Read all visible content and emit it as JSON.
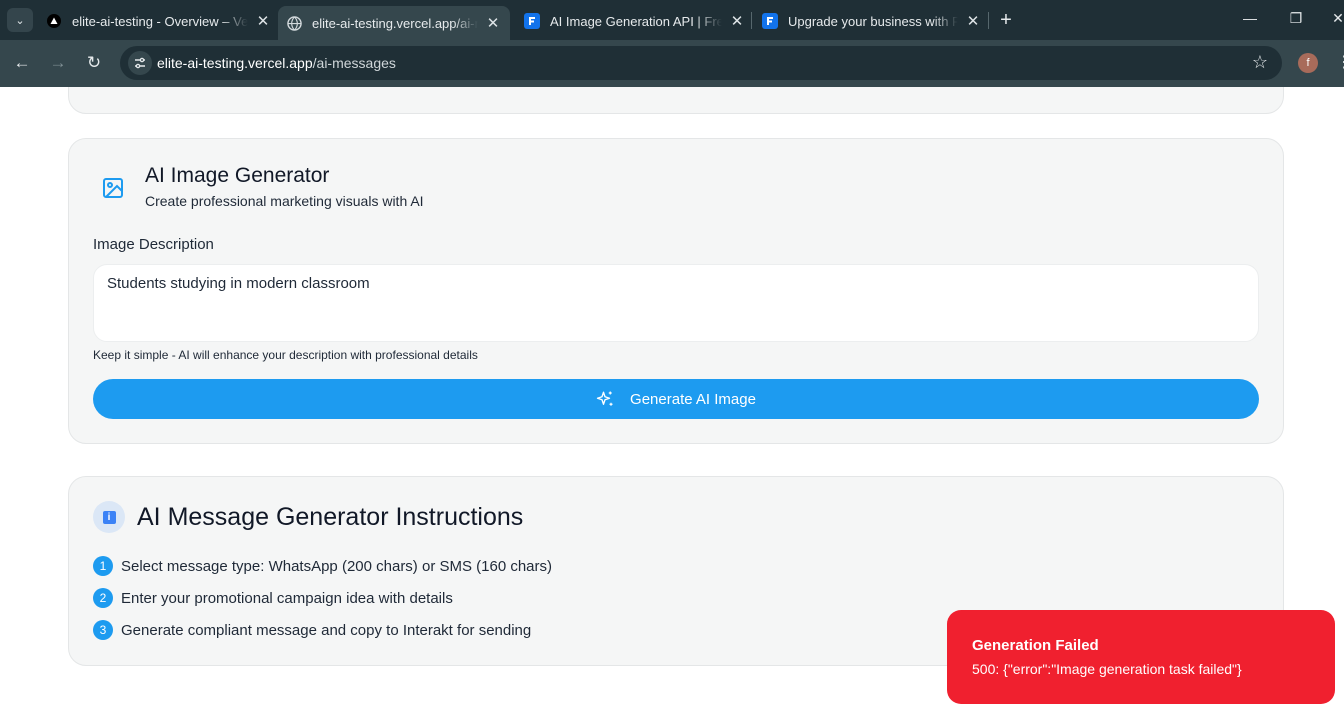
{
  "browser": {
    "tabs": [
      {
        "title": "elite-ai-testing - Overview – Vercel",
        "favicon": "vercel-triangle-icon",
        "active": false
      },
      {
        "title": "elite-ai-testing.vercel.app/ai-messages",
        "favicon": "globe-icon",
        "active": true
      },
      {
        "title": "AI Image Generation API | Freepik",
        "favicon": "freepik-icon",
        "active": false
      },
      {
        "title": "Upgrade your business with Freepik",
        "favicon": "freepik-icon",
        "active": false
      }
    ],
    "url_host": "elite-ai-testing.vercel.app",
    "url_path": "/ai-messages",
    "profile_initial": "f"
  },
  "image_generator": {
    "title": "AI Image Generator",
    "subtitle": "Create professional marketing visuals with AI",
    "description_label": "Image Description",
    "description_value": "Students studying in modern classroom",
    "hint": "Keep it simple - AI will enhance your description with professional details",
    "generate_label": "Generate AI Image"
  },
  "instructions": {
    "title": "AI Message Generator Instructions",
    "steps": [
      {
        "num": "1",
        "text": "Select message type: WhatsApp (200 chars) or SMS (160 chars)"
      },
      {
        "num": "2",
        "text": "Enter your promotional campaign idea with details"
      },
      {
        "num": "3",
        "text": "Generate compliant message and copy to Interakt for sending"
      }
    ]
  },
  "toast": {
    "title": "Generation Failed",
    "message": "500: {\"error\":\"Image generation task failed\"}"
  },
  "colors": {
    "accent": "#1d9bf0",
    "error": "#f0202f",
    "chrome_dark": "#1f2f36",
    "chrome_mid": "#35474d"
  }
}
